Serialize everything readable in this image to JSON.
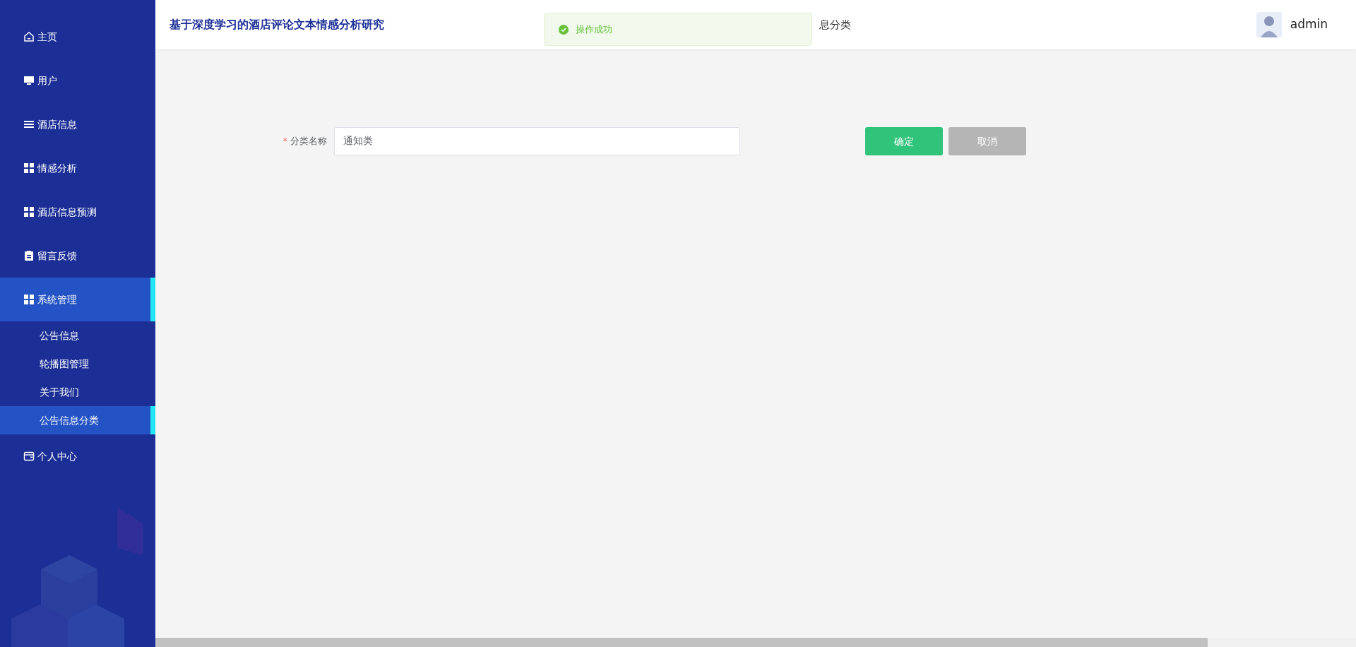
{
  "sidebar": {
    "items": [
      {
        "label": "主页",
        "kind": "home",
        "selected": false
      },
      {
        "label": "用户",
        "kind": "monitor",
        "selected": false
      },
      {
        "label": "酒店信息",
        "kind": "list",
        "selected": false
      },
      {
        "label": "情感分析",
        "kind": "grid",
        "selected": false
      },
      {
        "label": "酒店信息预测",
        "kind": "grid",
        "selected": false
      },
      {
        "label": "留言反馈",
        "kind": "clipboard",
        "selected": false
      },
      {
        "label": "系统管理",
        "kind": "grid",
        "selected": true,
        "children": [
          {
            "label": "公告信息",
            "selected": false
          },
          {
            "label": "轮播图管理",
            "selected": false
          },
          {
            "label": "关于我们",
            "selected": false
          },
          {
            "label": "公告信息分类",
            "selected": true
          }
        ]
      },
      {
        "label": "个人中心",
        "kind": "card",
        "selected": false
      }
    ]
  },
  "header": {
    "title": "基于深度学习的酒店评论文本情感分析研究",
    "breadcrumb": "息分类",
    "user": "admin"
  },
  "toast": {
    "kind": "success",
    "message": "操作成功"
  },
  "form": {
    "fields": [
      {
        "label": "分类名称",
        "required": true,
        "required_mark": "*",
        "value": "通知类"
      }
    ],
    "buttons": [
      {
        "label": "确定",
        "kind": "primary"
      },
      {
        "label": "取消",
        "kind": "secondary"
      }
    ]
  }
}
